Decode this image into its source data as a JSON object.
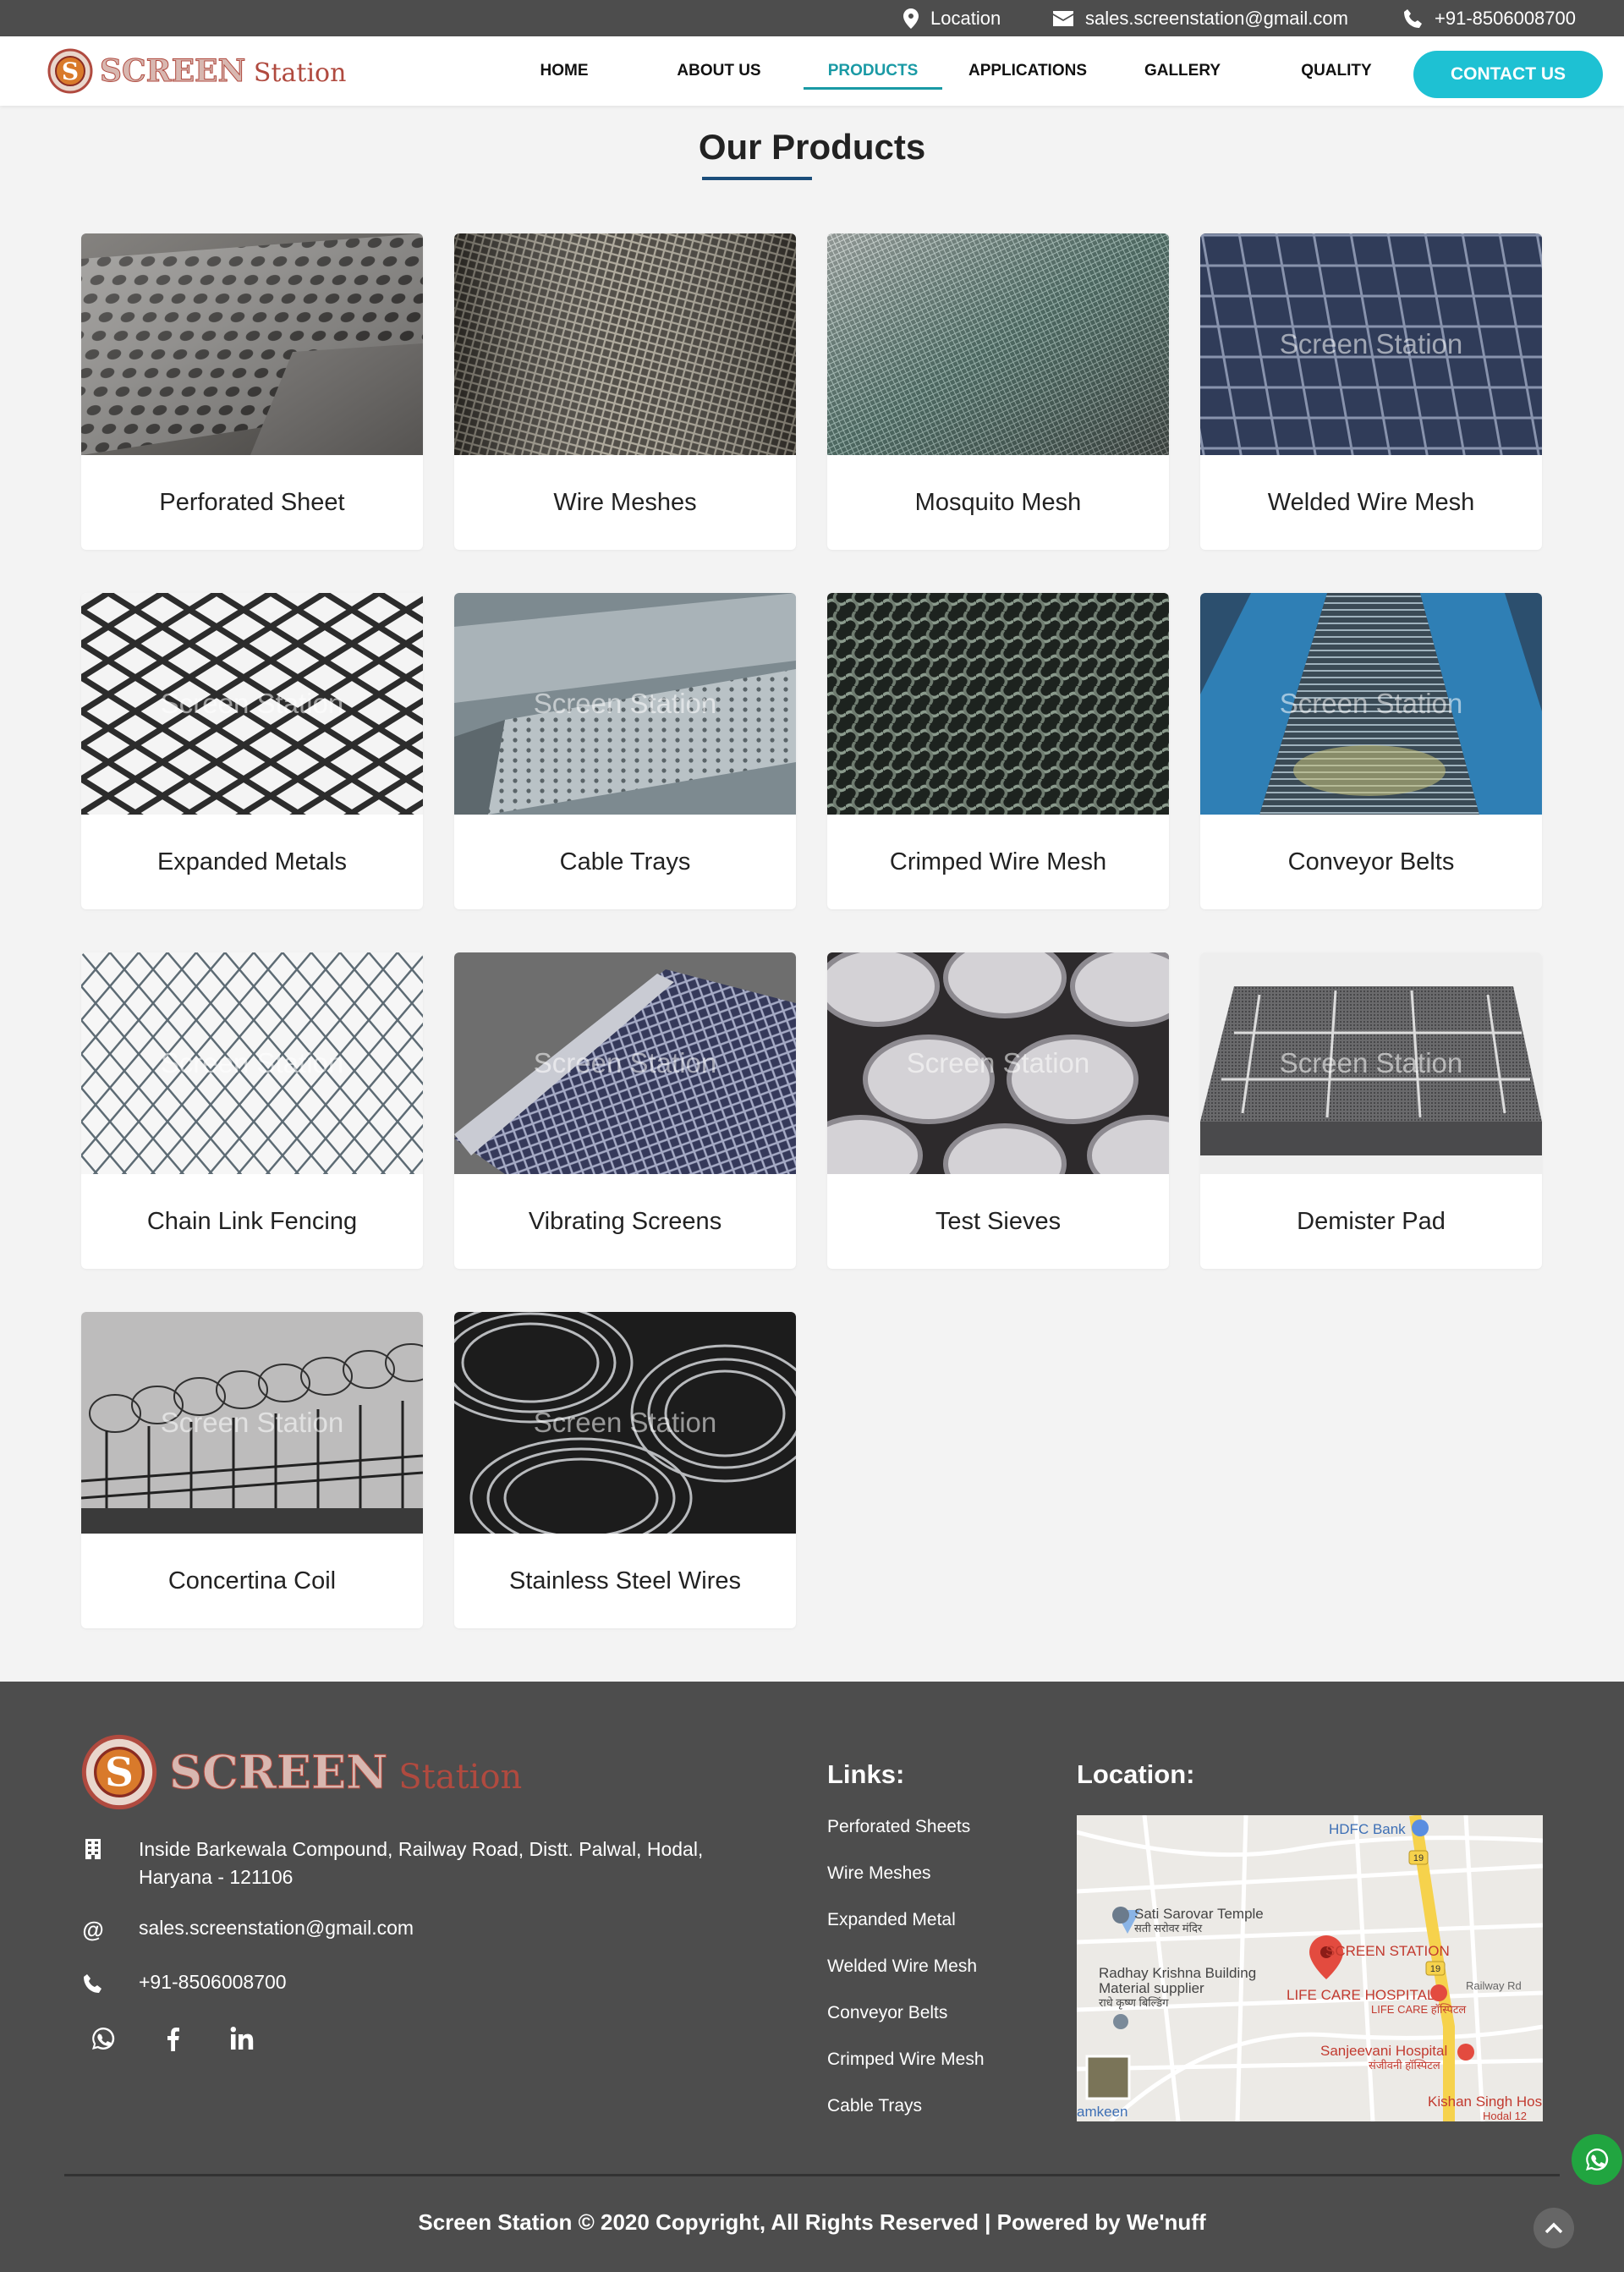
{
  "topbar": {
    "location": "Location",
    "email": "sales.screenstation@gmail.com",
    "phone": "+91-8506008700"
  },
  "brand": {
    "name_main": "SCREEN",
    "name_sub": "Station",
    "logo_initial": "S",
    "brand_color": "#b04a3f"
  },
  "nav": {
    "items": [
      "HOME",
      "ABOUT US",
      "PRODUCTS",
      "APPLICATIONS",
      "GALLERY",
      "QUALITY"
    ],
    "active": "PRODUCTS",
    "contact_label": "CONTACT US",
    "accent_color": "#1ec1d3"
  },
  "section": {
    "title": "Our Products"
  },
  "products": {
    "watermark": "Screen Station",
    "items": [
      {
        "name": "Perforated Sheet"
      },
      {
        "name": "Wire Meshes"
      },
      {
        "name": "Mosquito Mesh"
      },
      {
        "name": "Welded Wire Mesh"
      },
      {
        "name": "Expanded Metals"
      },
      {
        "name": "Cable Trays"
      },
      {
        "name": "Crimped Wire Mesh"
      },
      {
        "name": "Conveyor Belts"
      },
      {
        "name": "Chain Link Fencing"
      },
      {
        "name": "Vibrating Screens"
      },
      {
        "name": "Test Sieves"
      },
      {
        "name": "Demister Pad"
      },
      {
        "name": "Concertina Coil"
      },
      {
        "name": "Stainless Steel Wires"
      }
    ]
  },
  "footer": {
    "address": "Inside Barkewala Compound, Railway Road, Distt. Palwal, Hodal, Haryana - 121106",
    "email": "sales.screenstation@gmail.com",
    "phone": "+91-8506008700",
    "links_heading": "Links:",
    "links": [
      "Perforated Sheets",
      "Wire Meshes",
      "Expanded Metal",
      "Welded Wire Mesh",
      "Conveyor Belts",
      "Crimped Wire Mesh",
      "Cable Trays"
    ],
    "location_heading": "Location:",
    "map_labels": {
      "bank": "HDFC Bank",
      "temple": "Sati Sarovar Temple",
      "temple_hi": "सती सरोवर मंदिर",
      "marker": "SCREEN STATION",
      "building": "Radhay Krishna Building",
      "building_sub": "Material supplier",
      "building_hi": "राधे कृष्ण बिल्डिंग",
      "hospital1": "LIFE CARE HOSPITAL",
      "hospital1_hi": "LIFE CARE हॉस्पिटल",
      "hospital2": "Sanjeevani Hospital",
      "hospital2_hi": "संजीवनी हॉस्पिटल",
      "hospital3": "Kishan Singh Hos",
      "road": "Railway Rd",
      "road_num": "19",
      "namkeen": "amkeen",
      "hodal": "Hodal 12"
    },
    "copyright": "Screen Station © 2020 Copyright, All Rights Reserved | Powered by We'nuff"
  }
}
